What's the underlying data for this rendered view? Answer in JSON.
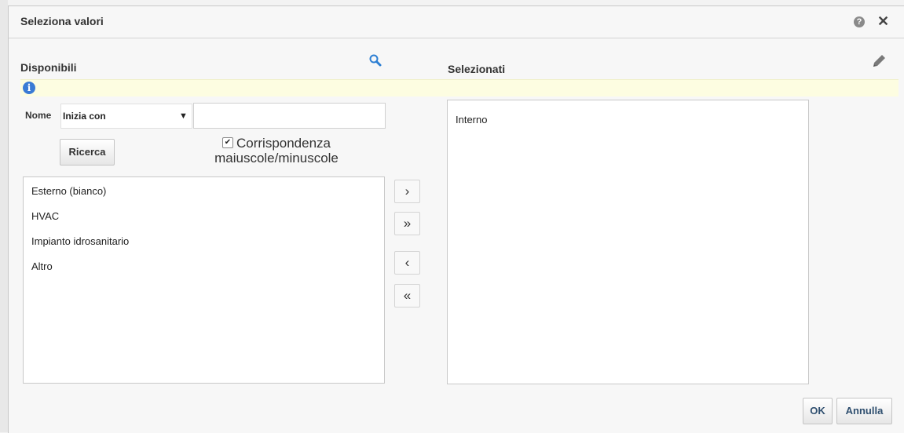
{
  "dialog": {
    "title": "Seleziona valori",
    "help_icon": "help-icon",
    "close_icon": "close-icon",
    "close_glyph": "✕"
  },
  "available": {
    "title": "Disponibili",
    "search_icon": "search-icon",
    "filter": {
      "label": "Nome",
      "operator_selected": "Inizia con",
      "value": ""
    },
    "search_button": "Ricerca",
    "case_sensitive": {
      "checked": true,
      "label": "Corrispondenza maiuscole/minuscole"
    },
    "items": [
      "Esterno (bianco)",
      "HVAC",
      "Impianto idrosanitario",
      "Altro"
    ]
  },
  "selected": {
    "title": "Selezionati",
    "edit_icon": "pencil-icon",
    "items": [
      "Interno"
    ]
  },
  "move_buttons": {
    "move": "›",
    "move_all": "»",
    "remove": "‹",
    "remove_all": "«"
  },
  "footer": {
    "ok": "OK",
    "cancel": "Annulla"
  },
  "colors": {
    "info_bar": "#fdfde1",
    "info_icon": "#3a7bd5",
    "search_icon": "#2d7fd3",
    "button_text": "#2f4f6f"
  }
}
